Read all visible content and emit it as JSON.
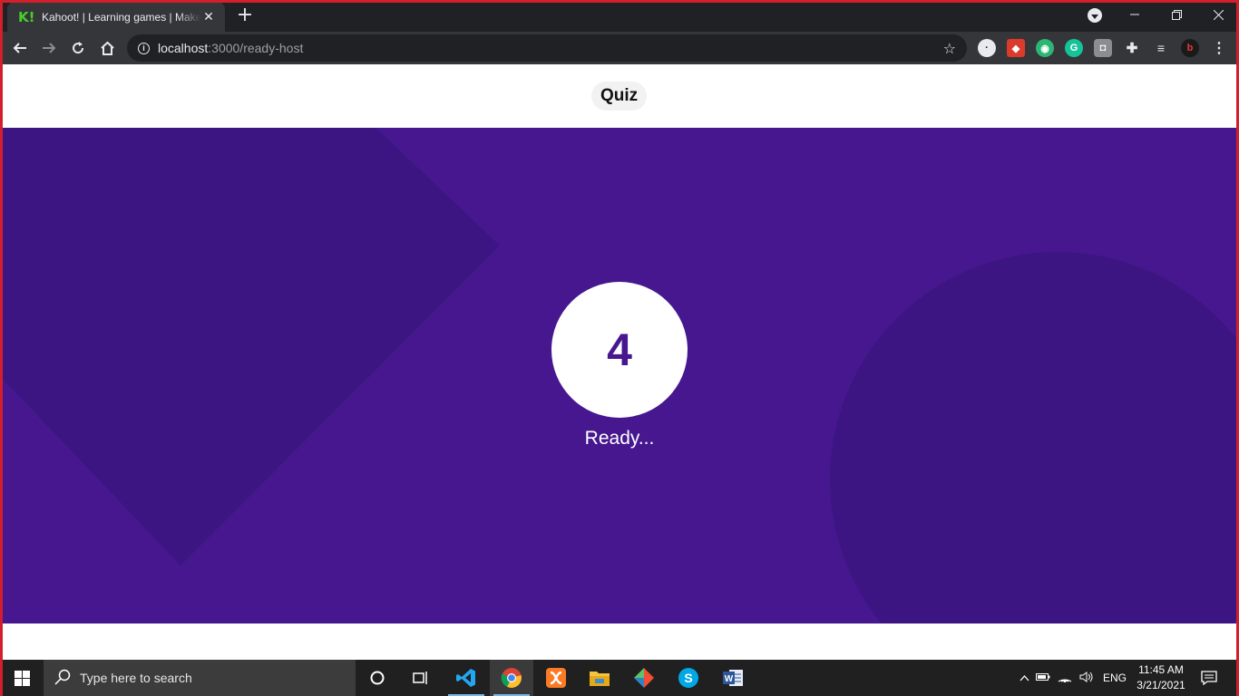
{
  "browser": {
    "tab_title": "Kahoot! | Learning games | Make learning awesome!",
    "tab_favicon": "K!",
    "new_tab_label": "+",
    "url_host": "localhost",
    "url_path": ":3000/ready-host"
  },
  "page": {
    "quiz_label": "Quiz",
    "countdown_value": "4",
    "status_text": "Ready..."
  },
  "taskbar": {
    "search_placeholder": "Type here to search",
    "language": "ENG",
    "time": "11:45 AM",
    "date": "3/21/2021"
  },
  "colors": {
    "stage_purple": "#46178f",
    "deco_purple": "#3d1582"
  }
}
